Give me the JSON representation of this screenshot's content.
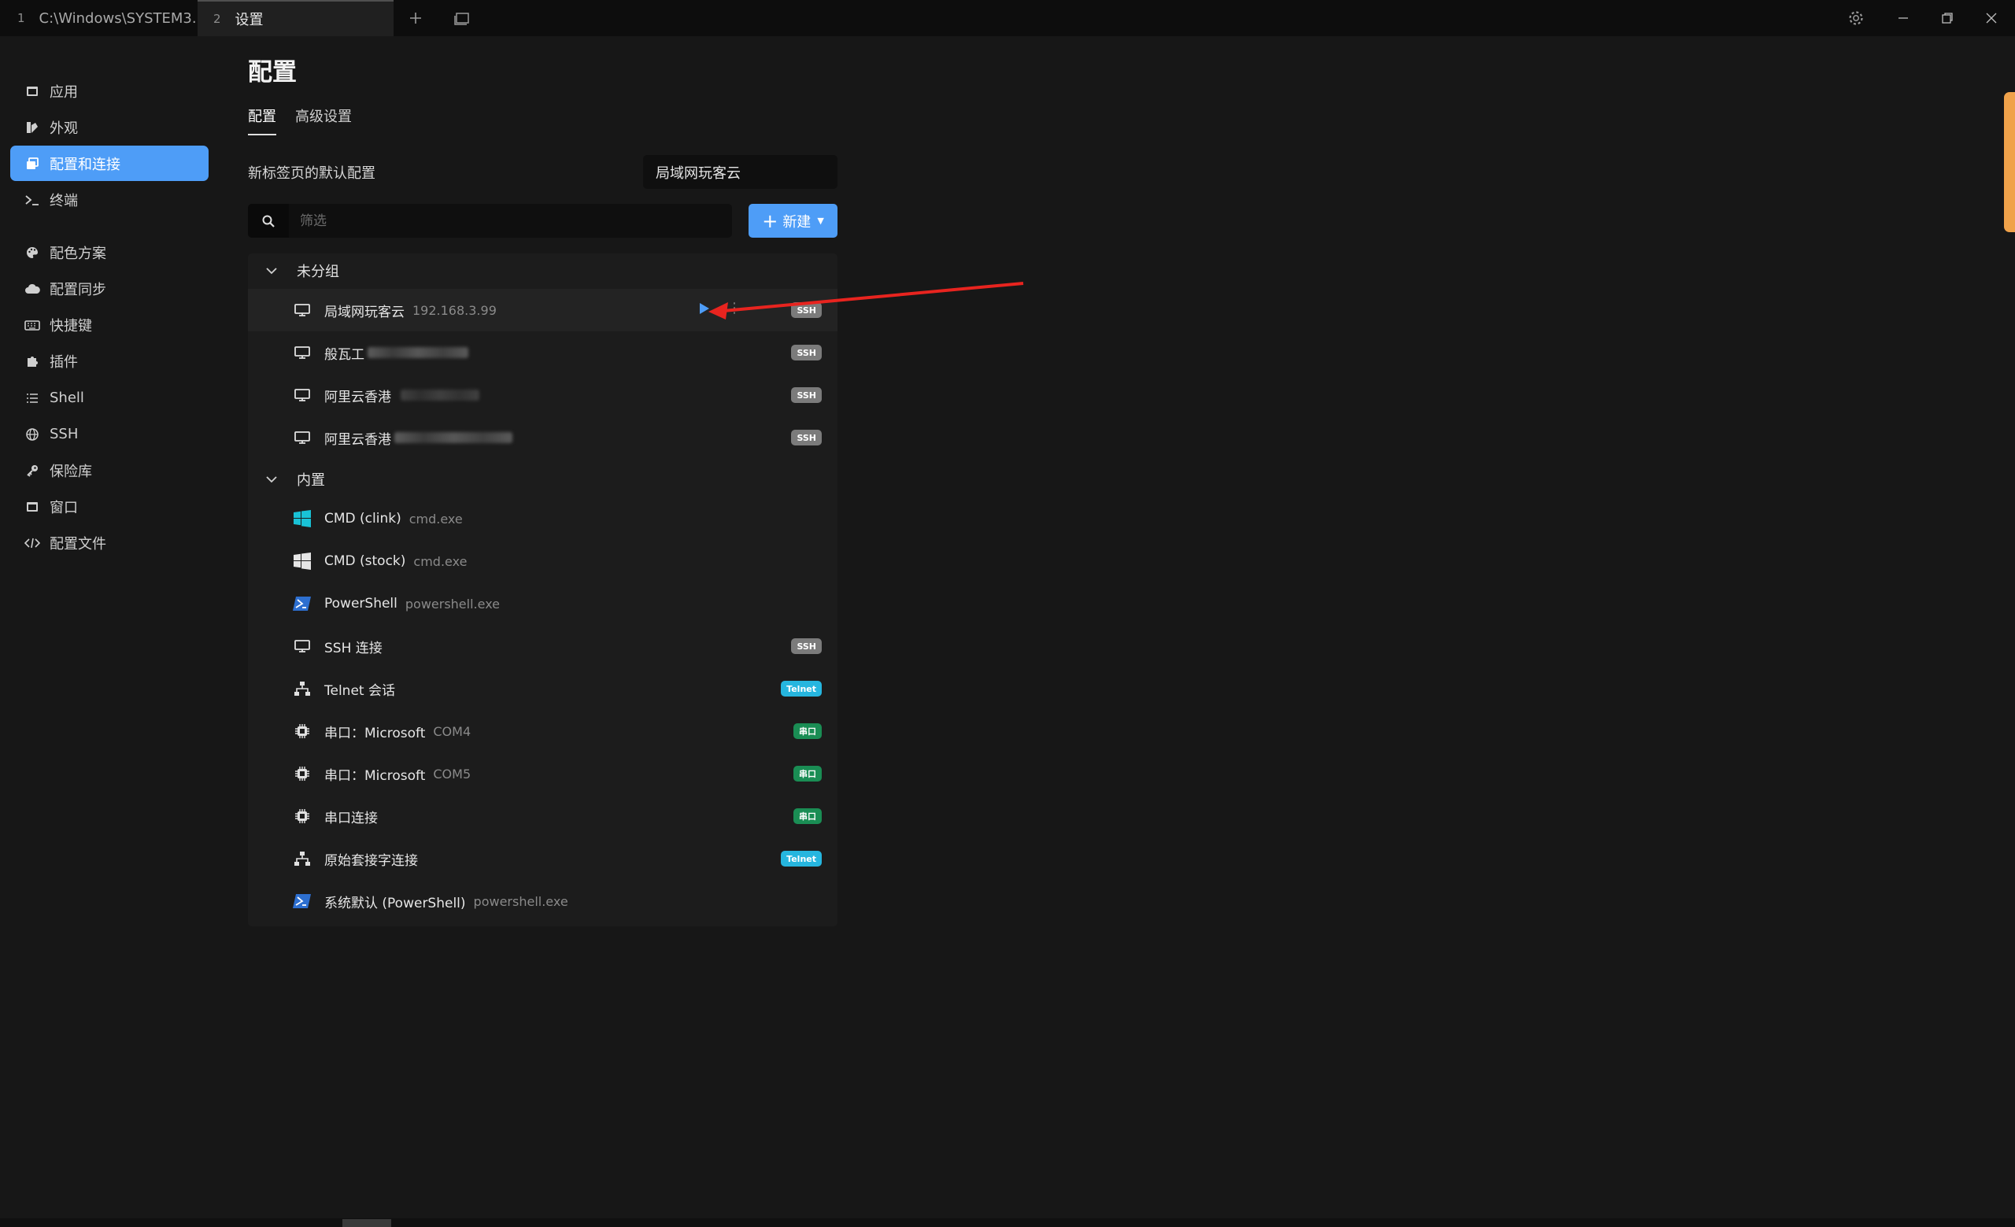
{
  "titlebar": {
    "tabs": [
      {
        "num": "1",
        "label": "C:\\Windows\\SYSTEM3..."
      },
      {
        "num": "2",
        "label": "设置"
      }
    ],
    "icons": [
      "plus-icon",
      "window-icon",
      "gear-icon",
      "minimize-icon",
      "restore-icon",
      "close-icon"
    ]
  },
  "sidebar": {
    "items": [
      {
        "label": "应用",
        "icon": "app-icon"
      },
      {
        "label": "外观",
        "icon": "appearance-icon"
      },
      {
        "label": "配置和连接",
        "icon": "profiles-icon",
        "active": true
      },
      {
        "label": "终端",
        "icon": "terminal-icon"
      },
      {
        "label": "配色方案",
        "icon": "palette-icon"
      },
      {
        "label": "配置同步",
        "icon": "cloud-icon"
      },
      {
        "label": "快捷键",
        "icon": "keyboard-icon"
      },
      {
        "label": "插件",
        "icon": "puzzle-icon"
      },
      {
        "label": "Shell",
        "icon": "list-icon"
      },
      {
        "label": "SSH",
        "icon": "globe-icon"
      },
      {
        "label": "保险库",
        "icon": "key-icon"
      },
      {
        "label": "窗口",
        "icon": "window-icon"
      },
      {
        "label": "配置文件",
        "icon": "code-icon"
      }
    ]
  },
  "main": {
    "title": "配置",
    "tabs": [
      {
        "label": "配置",
        "active": true
      },
      {
        "label": "高级设置"
      }
    ],
    "default_profile_label": "新标签页的默认配置",
    "default_profile_value": "局域网玩客云",
    "filter_placeholder": "筛选",
    "new_button_label": "新建",
    "groups": [
      {
        "name": "未分组",
        "profiles": [
          {
            "name": "局域网玩客云",
            "sub": "192.168.3.99",
            "badge": "SSH",
            "icon": "monitor-icon"
          },
          {
            "name": "般瓦工",
            "sub": "",
            "badge": "SSH",
            "icon": "monitor-icon"
          },
          {
            "name": "阿里云香港",
            "sub": "",
            "badge": "SSH",
            "icon": "monitor-icon"
          },
          {
            "name": "阿里云香港",
            "sub": "",
            "badge": "SSH",
            "icon": "monitor-icon"
          }
        ]
      },
      {
        "name": "内置",
        "profiles": [
          {
            "name": "CMD (clink)",
            "sub": "cmd.exe",
            "badge": "",
            "icon": "windows-color-icon"
          },
          {
            "name": "CMD (stock)",
            "sub": "cmd.exe",
            "badge": "",
            "icon": "windows-icon"
          },
          {
            "name": "PowerShell",
            "sub": "powershell.exe",
            "badge": "",
            "icon": "powershell-icon"
          },
          {
            "name": "SSH 连接",
            "sub": "",
            "badge": "SSH",
            "icon": "monitor-icon"
          },
          {
            "name": "Telnet 会话",
            "sub": "",
            "badge": "Telnet",
            "icon": "network-icon"
          },
          {
            "name": "串口：Microsoft",
            "sub": "COM4",
            "badge": "串口",
            "icon": "chip-icon"
          },
          {
            "name": "串口：Microsoft",
            "sub": "COM5",
            "badge": "串口",
            "icon": "chip-icon"
          },
          {
            "name": "串口连接",
            "sub": "",
            "badge": "串口",
            "icon": "chip-icon"
          },
          {
            "name": "原始套接字连接",
            "sub": "",
            "badge": "Telnet",
            "icon": "network-icon"
          },
          {
            "name": "系统默认 (PowerShell)",
            "sub": "powershell.exe",
            "badge": "",
            "icon": "powershell-icon"
          }
        ]
      }
    ]
  },
  "colors": {
    "accent": "#4e9df7",
    "ssh_badge": "#7b7b7b",
    "telnet_badge": "#26b6df",
    "serial_badge": "#1a8d54",
    "annotation_arrow": "#e8241f",
    "scroll_accent": "#f0a24a"
  }
}
